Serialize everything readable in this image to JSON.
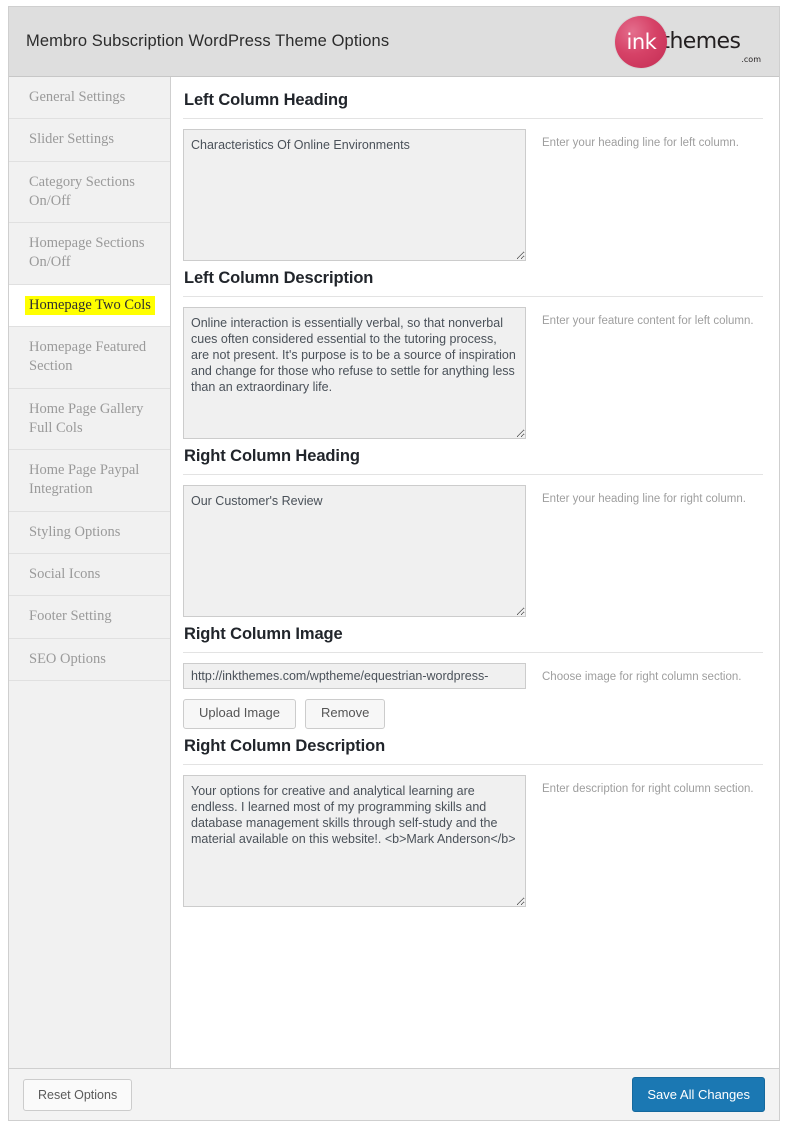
{
  "header": {
    "title": "Membro Subscription WordPress Theme Options",
    "logo": {
      "mark_text": "ink",
      "word_text": "themes",
      "suffix_text": ".com",
      "circle_color": "#cf3a60"
    }
  },
  "sidebar": {
    "items": [
      {
        "label": "General Settings",
        "active": false
      },
      {
        "label": "Slider Settings",
        "active": false
      },
      {
        "label": "Category Sections On/Off",
        "active": false
      },
      {
        "label": "Homepage Sections On/Off",
        "active": false
      },
      {
        "label": "Homepage Two Cols",
        "active": true
      },
      {
        "label": "Homepage Featured Section",
        "active": false
      },
      {
        "label": "Home Page Gallery Full Cols",
        "active": false
      },
      {
        "label": "Home Page Paypal Integration",
        "active": false
      },
      {
        "label": "Styling Options",
        "active": false
      },
      {
        "label": "Social Icons",
        "active": false
      },
      {
        "label": "Footer Setting",
        "active": false
      },
      {
        "label": "SEO Options",
        "active": false
      }
    ],
    "highlight_color": "#ffff00"
  },
  "main": {
    "sections": [
      {
        "title": "Left Column Heading",
        "value": "Characteristics Of Online Environments",
        "hint": "Enter your heading line for left column."
      },
      {
        "title": "Left Column Description",
        "value": "Online interaction is essentially verbal, so that nonverbal cues often considered essential to the tutoring process, are not present. It's purpose is to be a source of inspiration and change for those who refuse to settle for anything less than an extraordinary life.",
        "hint": "Enter your feature content for left column."
      },
      {
        "title": "Right Column Heading",
        "value": "Our Customer's Review",
        "hint": "Enter your heading line for right column."
      },
      {
        "title": "Right Column Image",
        "value": "http://inkthemes.com/wptheme/equestrian-wordpress-",
        "hint": "Choose image for right column section.",
        "upload_label": "Upload Image",
        "remove_label": "Remove"
      },
      {
        "title": "Right Column Description",
        "value": "Your options for creative and analytical learning are endless. I learned most of my programming skills and database management skills through self-study and the material available on this website!. <b>Mark Anderson</b>",
        "hint": "Enter description for right column section."
      }
    ]
  },
  "footer": {
    "reset_label": "Reset Options",
    "save_label": "Save All Changes",
    "save_color": "#1b78b3"
  }
}
